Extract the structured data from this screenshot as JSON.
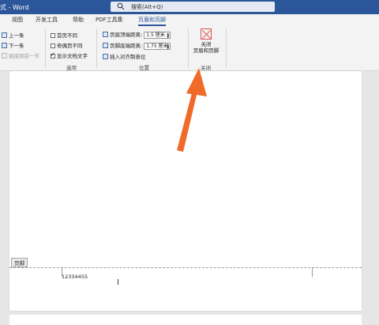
{
  "titlebar": {
    "title": "式 - Word",
    "search_placeholder": "搜索(Alt+Q)"
  },
  "tabs": [
    "视图",
    "开发工具",
    "帮助",
    "PDF工具集",
    "页眉和页脚"
  ],
  "ribbon": {
    "nav": {
      "prev": "上一条",
      "next": "下一条",
      "link_prev": "链接到前一节"
    },
    "options": {
      "label": "选项",
      "different_first": "首页不同",
      "different_odd_even": "奇偶页不同",
      "show_doc_text": "显示文档文字"
    },
    "position": {
      "label": "位置",
      "header_from_top": "页眉顶端距离:",
      "header_from_top_value": "1.5 厘米",
      "footer_from_bottom": "页脚底端距离:",
      "footer_from_bottom_value": "1.75 厘米",
      "insert_align_tab": "插入对齐制表位"
    },
    "close": {
      "label_line1": "关闭",
      "label_line2": "页眉和页脚",
      "group_label": "关闭"
    }
  },
  "document": {
    "footer_tag": "页脚",
    "footer_text": "12334455"
  },
  "colors": {
    "word_blue": "#2b579a",
    "arrow_orange": "#f06a2a"
  }
}
